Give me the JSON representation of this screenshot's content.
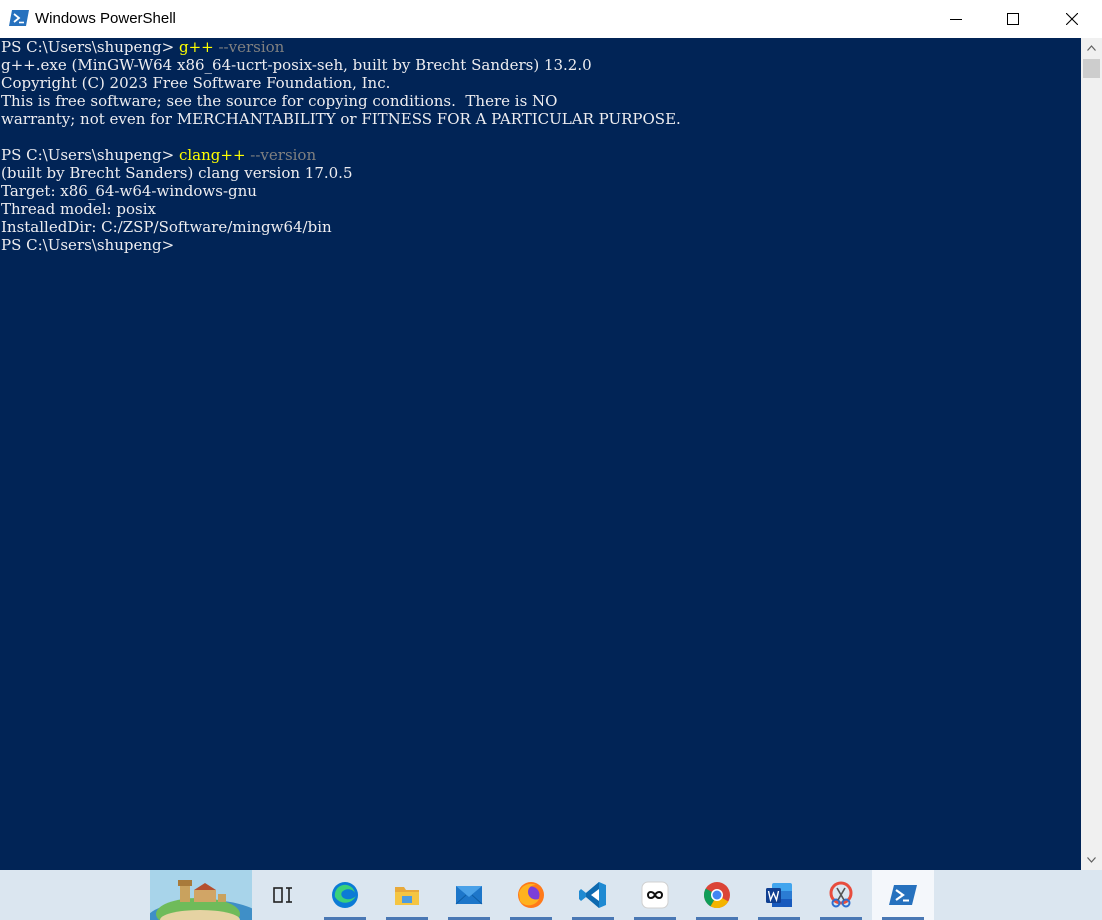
{
  "window": {
    "title": "Windows PowerShell",
    "icons": {
      "app": "powershell-icon",
      "minimize": "minimize-icon",
      "maximize": "maximize-icon",
      "close": "close-icon"
    }
  },
  "console": {
    "lines": [
      {
        "prompt": "PS C:\\Users\\shupeng> ",
        "cmd": "g++",
        "param": " --version"
      },
      {
        "text": "g++.exe (MinGW-W64 x86_64-ucrt-posix-seh, built by Brecht Sanders) 13.2.0"
      },
      {
        "text": "Copyright (C) 2023 Free Software Foundation, Inc."
      },
      {
        "text": "This is free software; see the source for copying conditions.  There is NO"
      },
      {
        "text": "warranty; not even for MERCHANTABILITY or FITNESS FOR A PARTICULAR PURPOSE."
      },
      {
        "text": ""
      },
      {
        "prompt": "PS C:\\Users\\shupeng> ",
        "cmd": "clang++",
        "param": " --version"
      },
      {
        "text": "(built by Brecht Sanders) clang version 17.0.5"
      },
      {
        "text": "Target: x86_64-w64-windows-gnu"
      },
      {
        "text": "Thread model: posix"
      },
      {
        "text": "InstalledDir: C:/ZSP/Software/mingw64/bin"
      },
      {
        "prompt": "PS C:\\Users\\shupeng>"
      }
    ],
    "colors": {
      "background": "#012456",
      "text": "#eeedf0",
      "command": "#ffff00",
      "parameter": "#808080"
    }
  },
  "taskbar": {
    "items": [
      {
        "icon": "task-view-icon",
        "active": false
      },
      {
        "icon": "edge-icon",
        "active": true
      },
      {
        "icon": "file-explorer-icon",
        "active": true
      },
      {
        "icon": "mail-icon",
        "active": true
      },
      {
        "icon": "firefox-icon",
        "active": true
      },
      {
        "icon": "vscode-icon",
        "active": true
      },
      {
        "icon": "infinity-app-icon",
        "active": true
      },
      {
        "icon": "chrome-icon",
        "active": true
      },
      {
        "icon": "word-icon",
        "active": true
      },
      {
        "icon": "snipping-tool-icon",
        "active": true
      },
      {
        "icon": "powershell-icon",
        "active": true,
        "focused": true
      }
    ]
  }
}
